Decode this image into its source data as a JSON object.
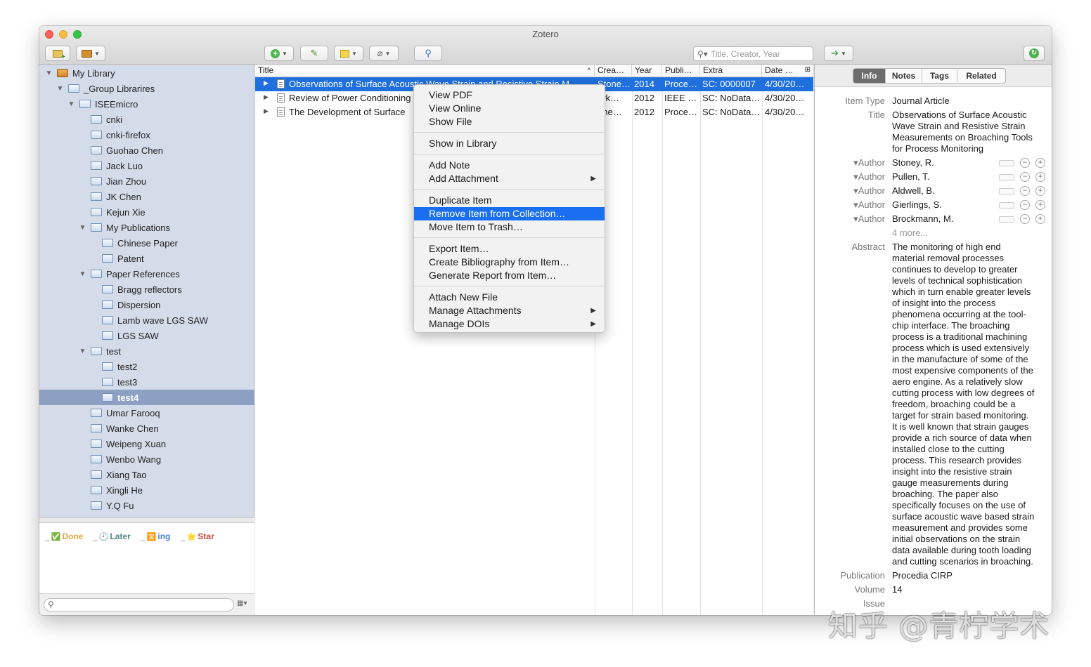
{
  "window": {
    "title": "Zotero"
  },
  "toolbar": {
    "search_placeholder": "Title, Creator, Year"
  },
  "tree": [
    {
      "label": "My Library",
      "indent": 0,
      "twisty": "▼",
      "icon": "library"
    },
    {
      "label": "_Group Librarires",
      "indent": 1,
      "twisty": "▼",
      "icon": "folder"
    },
    {
      "label": "ISEEmicro",
      "indent": 2,
      "twisty": "▼",
      "icon": "folder"
    },
    {
      "label": "cnki",
      "indent": 3,
      "twisty": "",
      "icon": "folder"
    },
    {
      "label": "cnki-firefox",
      "indent": 3,
      "twisty": "",
      "icon": "folder"
    },
    {
      "label": "Guohao Chen",
      "indent": 3,
      "twisty": "",
      "icon": "folder"
    },
    {
      "label": "Jack Luo",
      "indent": 3,
      "twisty": "",
      "icon": "folder"
    },
    {
      "label": "Jian Zhou",
      "indent": 3,
      "twisty": "",
      "icon": "folder"
    },
    {
      "label": "JK Chen",
      "indent": 3,
      "twisty": "",
      "icon": "folder"
    },
    {
      "label": "Kejun Xie",
      "indent": 3,
      "twisty": "",
      "icon": "folder"
    },
    {
      "label": "My Publications",
      "indent": 3,
      "twisty": "▼",
      "icon": "folder"
    },
    {
      "label": "Chinese Paper",
      "indent": 4,
      "twisty": "",
      "icon": "folder"
    },
    {
      "label": "Patent",
      "indent": 4,
      "twisty": "",
      "icon": "folder"
    },
    {
      "label": "Paper References",
      "indent": 3,
      "twisty": "▼",
      "icon": "folder"
    },
    {
      "label": "Bragg reflectors",
      "indent": 4,
      "twisty": "",
      "icon": "folder"
    },
    {
      "label": "Dispersion",
      "indent": 4,
      "twisty": "",
      "icon": "folder"
    },
    {
      "label": "Lamb wave LGS SAW",
      "indent": 4,
      "twisty": "",
      "icon": "folder"
    },
    {
      "label": "LGS SAW",
      "indent": 4,
      "twisty": "",
      "icon": "folder"
    },
    {
      "label": "test",
      "indent": 3,
      "twisty": "▼",
      "icon": "folder"
    },
    {
      "label": "test2",
      "indent": 4,
      "twisty": "",
      "icon": "folder"
    },
    {
      "label": "test3",
      "indent": 4,
      "twisty": "",
      "icon": "folder"
    },
    {
      "label": "test4",
      "indent": 4,
      "twisty": "",
      "icon": "folder",
      "selected": true
    },
    {
      "label": "Umar Farooq",
      "indent": 3,
      "twisty": "",
      "icon": "folder"
    },
    {
      "label": "Wanke Chen",
      "indent": 3,
      "twisty": "",
      "icon": "folder"
    },
    {
      "label": "Weipeng Xuan",
      "indent": 3,
      "twisty": "",
      "icon": "folder"
    },
    {
      "label": "Wenbo Wang",
      "indent": 3,
      "twisty": "",
      "icon": "folder"
    },
    {
      "label": "Xiang Tao",
      "indent": 3,
      "twisty": "",
      "icon": "folder"
    },
    {
      "label": "Xingli He",
      "indent": 3,
      "twisty": "",
      "icon": "folder"
    },
    {
      "label": "Y.Q Fu",
      "indent": 3,
      "twisty": "",
      "icon": "folder"
    }
  ],
  "tags": [
    {
      "prefix": "_",
      "symbol": "✅",
      "label": "Done",
      "color": "#e3a23b"
    },
    {
      "prefix": "_",
      "symbol": "🕘",
      "label": "Later",
      "color": "#4f8a8b"
    },
    {
      "prefix": "_",
      "symbol": "🈺",
      "label": "ing",
      "color": "#4a7fd4"
    },
    {
      "prefix": "_",
      "symbol": "🌟",
      "label": "Star",
      "color": "#c9473e"
    }
  ],
  "columns": [
    "Title",
    "Crea…",
    "Year",
    "Publi…",
    "Extra",
    "Date …"
  ],
  "items": [
    {
      "title": "Observations of Surface Acoustic Wave Strain and Resistive Strain M…",
      "creator": "Stone…",
      "year": "2014",
      "pub": "Proce…",
      "extra": "SC: 0000007",
      "date": "4/30/20…",
      "selected": true
    },
    {
      "title": "Review of Power Conditioning",
      "creator": "ark…",
      "year": "2012",
      "pub": "IEEE …",
      "extra": "SC: NoData…",
      "date": "4/30/20…"
    },
    {
      "title": "The Development of Surface",
      "creator": "one…",
      "year": "2012",
      "pub": "Proce…",
      "extra": "SC: NoData…",
      "date": "4/30/20…"
    }
  ],
  "context_menu": {
    "groups": [
      [
        {
          "label": "View PDF"
        },
        {
          "label": "View Online"
        },
        {
          "label": "Show File"
        }
      ],
      [
        {
          "label": "Show in Library"
        }
      ],
      [
        {
          "label": "Add Note"
        },
        {
          "label": "Add Attachment",
          "submenu": true
        }
      ],
      [
        {
          "label": "Duplicate Item"
        },
        {
          "label": "Remove Item from Collection…",
          "active": true
        },
        {
          "label": "Move Item to Trash…"
        }
      ],
      [
        {
          "label": "Export Item…"
        },
        {
          "label": "Create Bibliography from Item…"
        },
        {
          "label": "Generate Report from Item…"
        }
      ],
      [
        {
          "label": "Attach New File"
        },
        {
          "label": "Manage Attachments",
          "submenu": true
        },
        {
          "label": "Manage DOIs",
          "submenu": true
        }
      ]
    ]
  },
  "item_pane": {
    "tabs": [
      {
        "label": "Info",
        "active": true
      },
      {
        "label": "Notes"
      },
      {
        "label": "Tags"
      },
      {
        "label": "Related"
      }
    ],
    "item_type_label": "Item Type",
    "item_type": "Journal Article",
    "title_label": "Title",
    "title_lines": [
      "Observations of Surface Acoustic",
      "Wave Strain and Resistive Strain",
      "Measurements on Broaching Tools",
      "for Process Monitoring"
    ],
    "author_label": "Author",
    "authors": [
      "Stoney, R.",
      "Pullen, T.",
      "Aldwell, B.",
      "Gierlings, S.",
      "Brockmann, M."
    ],
    "more_authors": "4 more...",
    "abstract_label": "Abstract",
    "abstract_lines": [
      "The monitoring of high end",
      "material removal processes",
      "continues to develop to greater",
      "levels of technical sophistication",
      "which in turn enable greater levels",
      "of insight into the process",
      "phenomena occurring at the tool-",
      "chip interface. The broaching",
      "process is a traditional machining",
      "process which is used extensively",
      "in the manufacture of some of the",
      "most expensive components of the",
      "aero engine. As a relatively slow",
      "cutting process with low degrees of",
      "freedom, broaching could be a",
      "target for strain based monitoring.",
      "It is well known that strain gauges",
      "provide a rich source of data when",
      "installed close to the cutting",
      "process. This research provides",
      "insight into the resistive strain",
      "gauge measurements during",
      "broaching. The paper also",
      "specifically focuses on the use of",
      "surface acoustic wave based strain",
      "measurement and provides some",
      "initial observations on the strain",
      "data available during tooth loading",
      "and cutting scenarios in broaching."
    ],
    "publication_label": "Publication",
    "publication": "Procedia CIRP",
    "volume_label": "Volume",
    "volume": "14",
    "issue_label": "Issue"
  },
  "watermark": "知乎 @青柠学术"
}
